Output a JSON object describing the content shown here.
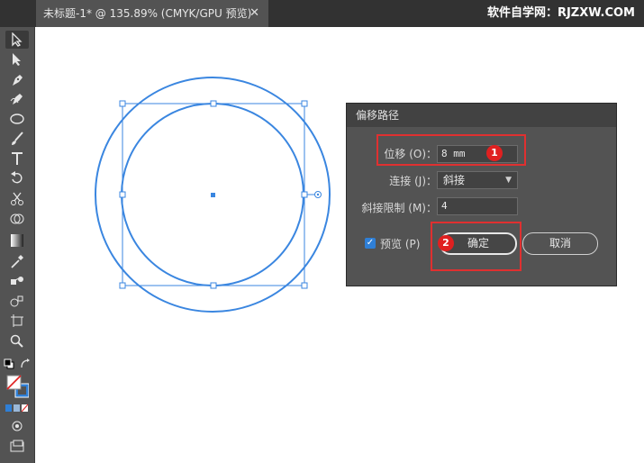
{
  "document_tab": {
    "title": "未标题-1* @ 135.89% (CMYK/GPU 预览)",
    "close_symbol": "✕"
  },
  "watermark": "软件自学网：RJZXW.COM",
  "tools": [
    "selection-tool",
    "direct-selection-tool",
    "pen-tool",
    "curvature-tool",
    "ellipse-tool",
    "paintbrush-tool",
    "type-tool",
    "rotate-tool",
    "scissors-tool",
    "shape-builder-tool",
    "gradient-tool",
    "eyedropper-tool",
    "blend-tool",
    "symbol-sprayer-tool",
    "artboard-tool",
    "zoom-tool",
    "swap-fill-stroke",
    "default-colors",
    "fill-stroke-swatch",
    "color-mode-buttons",
    "drawing-mode",
    "screen-mode"
  ],
  "dialog": {
    "title": "偏移路径",
    "offset_label": "位移 (O)：",
    "offset_value": "8 mm",
    "joins_label": "连接 (J)：",
    "joins_value": "斜接",
    "miter_label": "斜接限制 (M)：",
    "miter_value": "4",
    "preview_label": "预览 (P)",
    "preview_checked": true,
    "ok_label": "确定",
    "cancel_label": "取消"
  },
  "annotations": {
    "badge1": "1",
    "badge2": "2"
  },
  "colors": {
    "selection_blue": "#3a86e0",
    "annotation_red": "#e03030",
    "panel_gray": "#535353"
  }
}
